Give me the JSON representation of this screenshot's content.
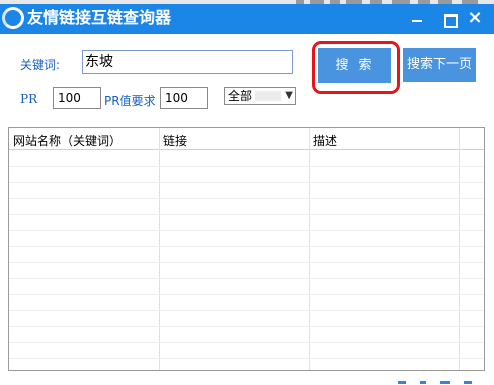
{
  "window": {
    "title": "友情链接互链查询器",
    "minimize_icon": "minimize-icon",
    "maximize_icon": "maximize-icon",
    "close_icon": "close-icon",
    "accent_color": "#1b86e6"
  },
  "form": {
    "keyword_label": "关键词:",
    "keyword_value": "东坡",
    "pr_label": "PR",
    "pr_value": "100",
    "pr_required_label": "PR值要求",
    "pr_required_value": "100",
    "scope_selected": "全部"
  },
  "buttons": {
    "search_label": "搜索",
    "next_page_label": "搜索下一页",
    "highlight_color": "#e8141b"
  },
  "table": {
    "columns": [
      "网站名称（关键词）",
      "链接",
      "描述"
    ],
    "rows": []
  }
}
